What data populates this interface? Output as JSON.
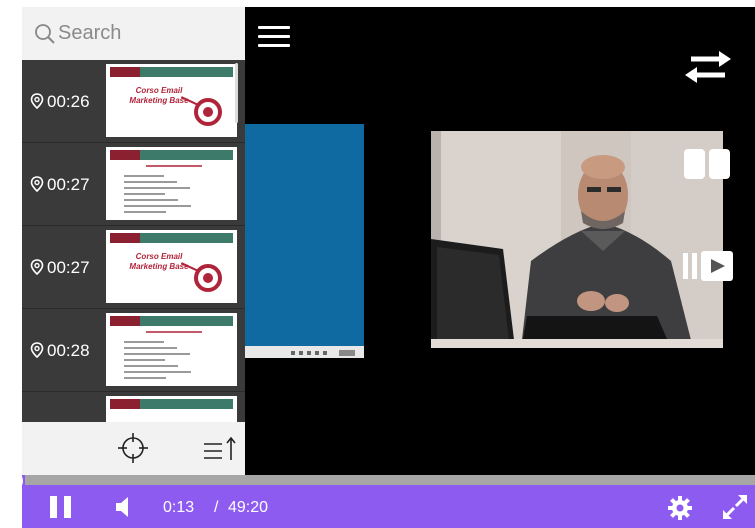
{
  "search": {
    "placeholder": "Search"
  },
  "index_items": [
    {
      "time": "00:26",
      "slide": "title",
      "title": "Corso Email Marketing Base"
    },
    {
      "time": "00:27",
      "slide": "list"
    },
    {
      "time": "00:27",
      "slide": "title",
      "title": "Corso Email Marketing Base"
    },
    {
      "time": "00:28",
      "slide": "list"
    },
    {
      "time": "",
      "slide": "partial"
    }
  ],
  "player": {
    "current_time": "0:13",
    "separator": "/",
    "total_time": "49:20",
    "progress": 0.0044
  },
  "colors": {
    "accent": "#8e5bf0",
    "sidebar_bg": "#3a3a3a",
    "slide_blue": "#0e6aa0",
    "slide_brand": "#b0243a"
  },
  "icons": {
    "search": "search-icon",
    "pin": "location-pin-icon",
    "sync": "crosshair-icon",
    "sort": "sort-list-icon",
    "menu": "hamburger-menu-icon",
    "swap": "swap-arrows-icon",
    "layout": "split-layout-icon",
    "presenter": "presenter-play-icon",
    "pause": "pause-icon",
    "volume": "volume-icon",
    "settings": "gear-icon",
    "fullscreen": "fullscreen-icon"
  }
}
